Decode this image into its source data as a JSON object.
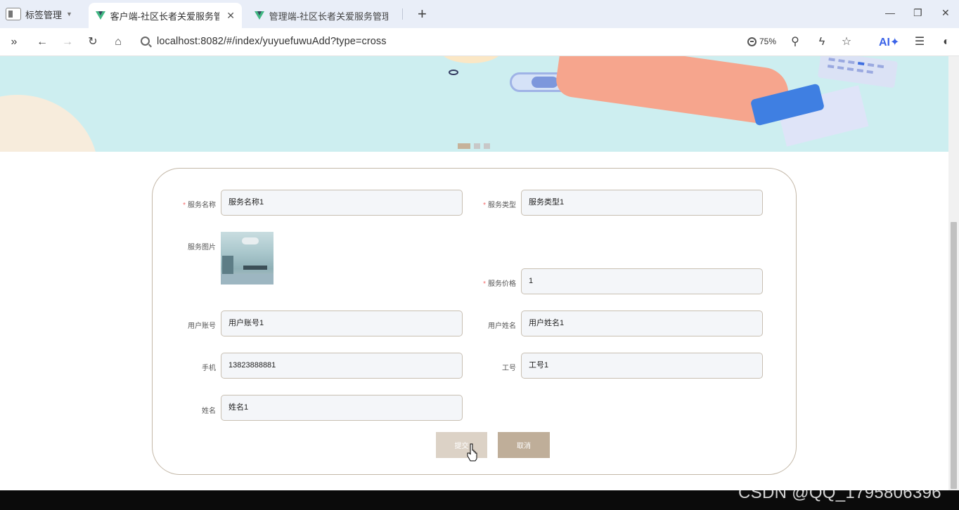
{
  "browser": {
    "tab_group_label": "标签管理",
    "tabs": [
      {
        "label": "客户端-社区长者关爱服务管理"
      },
      {
        "label": "管理端-社区长者关爱服务管理系"
      }
    ],
    "new_tab": "+",
    "window_controls": {
      "minimize": "—",
      "restore": "❐",
      "close": "✕"
    },
    "url": "localhost:8082/#/index/yuyuefuwuAdd?type=cross",
    "zoom": "75%",
    "ai_label": "AI✦"
  },
  "banner": {
    "slide_count": 3,
    "active_slide": 1
  },
  "form": {
    "fields": {
      "service_name": {
        "label": "服务名称",
        "value": "服务名称1",
        "required": true
      },
      "service_type": {
        "label": "服务类型",
        "value": "服务类型1",
        "required": true
      },
      "service_image": {
        "label": "服务图片"
      },
      "service_price": {
        "label": "服务价格",
        "value": "1",
        "required": true
      },
      "user_account": {
        "label": "用户账号",
        "value": "用户账号1"
      },
      "user_name": {
        "label": "用户姓名",
        "value": "用户姓名1"
      },
      "phone": {
        "label": "手机",
        "value": "13823888881"
      },
      "staff_no": {
        "label": "工号",
        "value": "工号1"
      },
      "name": {
        "label": "姓名",
        "value": "姓名1"
      }
    },
    "required_mark": "*",
    "buttons": {
      "submit": "提交",
      "cancel": "取消"
    }
  },
  "watermark": "CSDN @QQ_1795806396",
  "colors": {
    "banner_bg": "#cdeef0",
    "card_border": "#c4b8a8",
    "submit_btn": "#dcd2c6",
    "cancel_btn": "#bfae99",
    "required_star": "#f56c6c"
  }
}
